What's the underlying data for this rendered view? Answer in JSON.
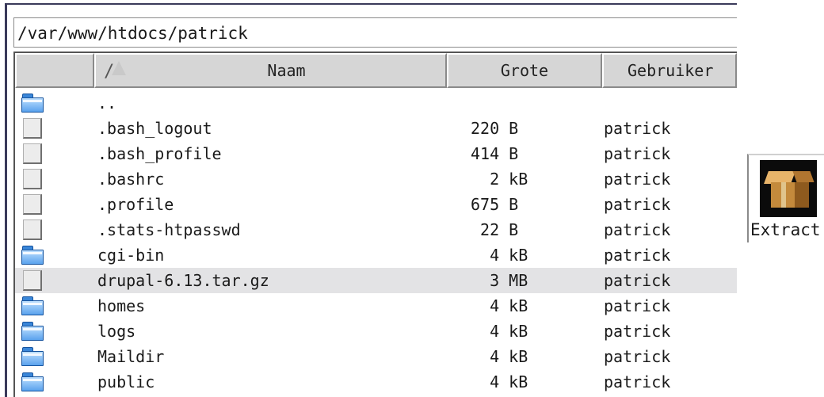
{
  "path": "/var/www/htdocs/patrick",
  "columns": {
    "sort_indicator": "/",
    "name": "Naam",
    "size": "Grote",
    "user": "Gebruiker"
  },
  "rows": [
    {
      "type": "folder",
      "name": "..",
      "size": "",
      "user": ""
    },
    {
      "type": "file",
      "name": ".bash_logout",
      "size": "220 B",
      "user": "patrick"
    },
    {
      "type": "file",
      "name": ".bash_profile",
      "size": "414 B",
      "user": "patrick"
    },
    {
      "type": "file",
      "name": ".bashrc",
      "size": "  2 kB",
      "user": "patrick"
    },
    {
      "type": "file",
      "name": ".profile",
      "size": "675 B",
      "user": "patrick"
    },
    {
      "type": "file",
      "name": ".stats-htpasswd",
      "size": " 22 B",
      "user": "patrick"
    },
    {
      "type": "folder",
      "name": "cgi-bin",
      "size": "  4 kB",
      "user": "patrick"
    },
    {
      "type": "file",
      "name": "drupal-6.13.tar.gz",
      "size": "  3 MB",
      "user": "patrick",
      "selected": true
    },
    {
      "type": "folder",
      "name": "homes",
      "size": "  4 kB",
      "user": "patrick"
    },
    {
      "type": "folder",
      "name": "logs",
      "size": "  4 kB",
      "user": "patrick"
    },
    {
      "type": "folder",
      "name": "Maildir",
      "size": "  4 kB",
      "user": "patrick"
    },
    {
      "type": "folder",
      "name": "public",
      "size": "  4 kB",
      "user": "patrick"
    }
  ],
  "extract_button": {
    "label": "Extract",
    "icon": "package-box-icon"
  },
  "colors": {
    "folder": "#3a86d8",
    "selected_row": "#e3e3e5",
    "header_bg": "#d6d6d6"
  }
}
